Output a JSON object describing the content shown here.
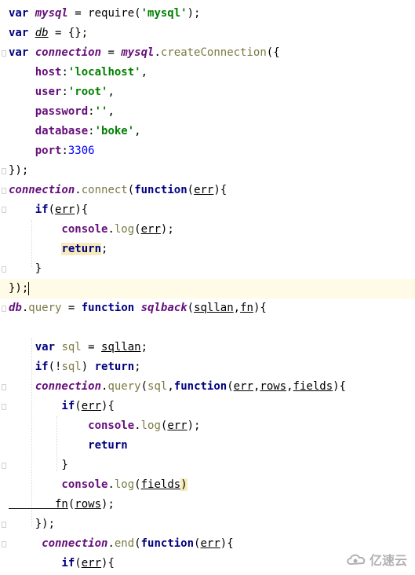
{
  "watermark_text": "亿速云",
  "lines": [
    {
      "tokens": [
        {
          "t": "var ",
          "c": "kw"
        },
        {
          "t": "mysql",
          "c": "vi"
        },
        {
          "t": " = require(",
          "c": "pl"
        },
        {
          "t": "'mysql'",
          "c": "str"
        },
        {
          "t": ");",
          "c": "pl"
        }
      ]
    },
    {
      "tokens": [
        {
          "t": "var ",
          "c": "kw"
        },
        {
          "t": "db",
          "c": "vi un"
        },
        {
          "t": " = {};",
          "c": "pl"
        }
      ]
    },
    {
      "tokens": [
        {
          "t": "var ",
          "c": "kw"
        },
        {
          "t": "connection",
          "c": "vi"
        },
        {
          "t": " = ",
          "c": "pl"
        },
        {
          "t": "mysql",
          "c": "vi"
        },
        {
          "t": ".",
          "c": "pl"
        },
        {
          "t": "createConnection",
          "c": "fn"
        },
        {
          "t": "({",
          "c": "pl"
        }
      ]
    },
    {
      "tokens": [
        {
          "t": "    host",
          "c": "mb"
        },
        {
          "t": ":",
          "c": "pl"
        },
        {
          "t": "'localhost'",
          "c": "str"
        },
        {
          "t": ",",
          "c": "pl"
        }
      ]
    },
    {
      "tokens": [
        {
          "t": "    user",
          "c": "mb"
        },
        {
          "t": ":",
          "c": "pl"
        },
        {
          "t": "'root'",
          "c": "str"
        },
        {
          "t": ",",
          "c": "pl"
        }
      ]
    },
    {
      "tokens": [
        {
          "t": "    password",
          "c": "mb"
        },
        {
          "t": ":",
          "c": "pl"
        },
        {
          "t": "''",
          "c": "str"
        },
        {
          "t": ",",
          "c": "pl"
        }
      ]
    },
    {
      "tokens": [
        {
          "t": "    database",
          "c": "mb"
        },
        {
          "t": ":",
          "c": "pl"
        },
        {
          "t": "'boke'",
          "c": "str"
        },
        {
          "t": ",",
          "c": "pl"
        }
      ]
    },
    {
      "tokens": [
        {
          "t": "    port",
          "c": "mb"
        },
        {
          "t": ":",
          "c": "pl"
        },
        {
          "t": "3306",
          "c": "num"
        }
      ]
    },
    {
      "tokens": [
        {
          "t": "});",
          "c": "pl"
        }
      ]
    },
    {
      "tokens": [
        {
          "t": "connection",
          "c": "vi"
        },
        {
          "t": ".",
          "c": "pl"
        },
        {
          "t": "connect",
          "c": "fn"
        },
        {
          "t": "(",
          "c": "pl"
        },
        {
          "t": "function",
          "c": "kw"
        },
        {
          "t": "(",
          "c": "pl"
        },
        {
          "t": "err",
          "c": "un"
        },
        {
          "t": "){",
          "c": "pl"
        }
      ]
    },
    {
      "tokens": [
        {
          "t": "    if",
          "c": "kw"
        },
        {
          "t": "(",
          "c": "pl"
        },
        {
          "t": "err",
          "c": "un"
        },
        {
          "t": "){",
          "c": "pl"
        }
      ]
    },
    {
      "tokens": [
        {
          "t": "        console",
          "c": "mb"
        },
        {
          "t": ".",
          "c": "pl"
        },
        {
          "t": "log",
          "c": "fn"
        },
        {
          "t": "(",
          "c": "pl"
        },
        {
          "t": "err",
          "c": "un"
        },
        {
          "t": ");",
          "c": "pl"
        }
      ]
    },
    {
      "tokens": [
        {
          "t": "        ",
          "c": "pl"
        },
        {
          "t": "return",
          "c": "kw mark"
        },
        {
          "t": ";",
          "c": "pl"
        }
      ]
    },
    {
      "tokens": [
        {
          "t": "    }",
          "c": "pl"
        }
      ]
    },
    {
      "hl": true,
      "tokens": [
        {
          "t": "});",
          "c": "pl"
        },
        {
          "t": "",
          "c": "caret"
        }
      ]
    },
    {
      "tokens": [
        {
          "t": "db",
          "c": "vi"
        },
        {
          "t": ".",
          "c": "pl"
        },
        {
          "t": "query",
          "c": "fn"
        },
        {
          "t": " = ",
          "c": "pl"
        },
        {
          "t": "function ",
          "c": "kw"
        },
        {
          "t": "sqlback",
          "c": "vi"
        },
        {
          "t": "(",
          "c": "pl"
        },
        {
          "t": "sqllan",
          "c": "un"
        },
        {
          "t": ",",
          "c": "pl"
        },
        {
          "t": "fn",
          "c": "un"
        },
        {
          "t": "){",
          "c": "pl"
        }
      ]
    },
    {
      "tokens": [
        {
          "t": "",
          "c": "pl"
        }
      ]
    },
    {
      "tokens": [
        {
          "t": "    var ",
          "c": "kw"
        },
        {
          "t": "sql",
          "c": "fn"
        },
        {
          "t": " = ",
          "c": "pl"
        },
        {
          "t": "sqllan",
          "c": "un"
        },
        {
          "t": ";",
          "c": "pl"
        }
      ]
    },
    {
      "tokens": [
        {
          "t": "    if",
          "c": "kw"
        },
        {
          "t": "(!",
          "c": "pl"
        },
        {
          "t": "sql",
          "c": "fn"
        },
        {
          "t": ") ",
          "c": "pl"
        },
        {
          "t": "return",
          "c": "kw"
        },
        {
          "t": ";",
          "c": "pl"
        }
      ]
    },
    {
      "tokens": [
        {
          "t": "    connection",
          "c": "vi"
        },
        {
          "t": ".",
          "c": "pl"
        },
        {
          "t": "query",
          "c": "fn"
        },
        {
          "t": "(",
          "c": "pl"
        },
        {
          "t": "sql",
          "c": "fn"
        },
        {
          "t": ",",
          "c": "pl"
        },
        {
          "t": "function",
          "c": "kw"
        },
        {
          "t": "(",
          "c": "pl"
        },
        {
          "t": "err",
          "c": "un"
        },
        {
          "t": ",",
          "c": "pl"
        },
        {
          "t": "rows",
          "c": "un"
        },
        {
          "t": ",",
          "c": "pl"
        },
        {
          "t": "fields",
          "c": "un"
        },
        {
          "t": "){",
          "c": "pl"
        }
      ]
    },
    {
      "tokens": [
        {
          "t": "        if",
          "c": "kw"
        },
        {
          "t": "(",
          "c": "pl"
        },
        {
          "t": "err",
          "c": "un"
        },
        {
          "t": "){",
          "c": "pl"
        }
      ]
    },
    {
      "tokens": [
        {
          "t": "            console",
          "c": "mb"
        },
        {
          "t": ".",
          "c": "pl"
        },
        {
          "t": "log",
          "c": "fn"
        },
        {
          "t": "(",
          "c": "pl"
        },
        {
          "t": "err",
          "c": "un"
        },
        {
          "t": ");",
          "c": "pl"
        }
      ]
    },
    {
      "tokens": [
        {
          "t": "            return",
          "c": "kw"
        }
      ]
    },
    {
      "tokens": [
        {
          "t": "        }",
          "c": "pl"
        }
      ]
    },
    {
      "tokens": [
        {
          "t": "        console",
          "c": "mb"
        },
        {
          "t": ".",
          "c": "pl"
        },
        {
          "t": "log",
          "c": "fn"
        },
        {
          "t": "(",
          "c": "pl"
        },
        {
          "t": "fields",
          "c": "un"
        },
        {
          "t": ")",
          "c": "pl mark"
        }
      ]
    },
    {
      "tokens": [
        {
          "t": "       fn",
          "c": "un"
        },
        {
          "t": "(",
          "c": "pl"
        },
        {
          "t": "rows",
          "c": "un"
        },
        {
          "t": ");",
          "c": "pl"
        }
      ]
    },
    {
      "tokens": [
        {
          "t": "    });",
          "c": "pl"
        }
      ]
    },
    {
      "tokens": [
        {
          "t": "     connection",
          "c": "vi"
        },
        {
          "t": ".",
          "c": "pl"
        },
        {
          "t": "end",
          "c": "fn"
        },
        {
          "t": "(",
          "c": "pl"
        },
        {
          "t": "function",
          "c": "kw"
        },
        {
          "t": "(",
          "c": "pl"
        },
        {
          "t": "err",
          "c": "un"
        },
        {
          "t": "){",
          "c": "pl"
        }
      ]
    },
    {
      "tokens": [
        {
          "t": "        if",
          "c": "kw"
        },
        {
          "t": "(",
          "c": "pl"
        },
        {
          "t": "err",
          "c": "un"
        },
        {
          "t": "){",
          "c": "pl"
        }
      ]
    }
  ]
}
